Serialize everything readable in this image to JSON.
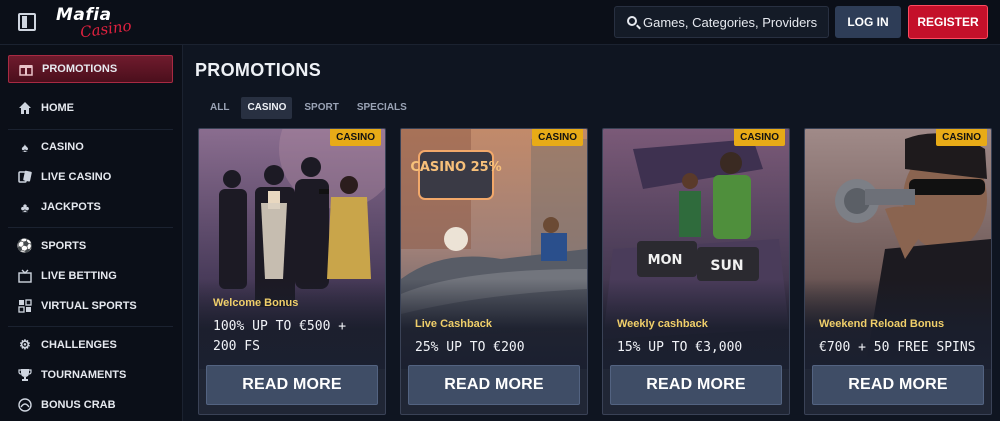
{
  "header": {
    "logo_main": "Mafia",
    "logo_script": "Casino",
    "search_placeholder": "Games, Categories, Providers",
    "login_label": "LOG IN",
    "register_label": "REGISTER"
  },
  "sidebar": {
    "items": [
      {
        "label": "PROMOTIONS",
        "icon": "gift-icon"
      },
      {
        "label": "HOME",
        "icon": "home-icon"
      },
      {
        "label": "CASINO",
        "icon": "spade-icon"
      },
      {
        "label": "LIVE CASINO",
        "icon": "cards-icon"
      },
      {
        "label": "JACKPOTS",
        "icon": "clover-icon"
      },
      {
        "label": "SPORTS",
        "icon": "football-icon"
      },
      {
        "label": "LIVE BETTING",
        "icon": "live-icon"
      },
      {
        "label": "VIRTUAL SPORTS",
        "icon": "virtual-icon"
      },
      {
        "label": "CHALLENGES",
        "icon": "gear-icon"
      },
      {
        "label": "TOURNAMENTS",
        "icon": "trophy-icon"
      },
      {
        "label": "BONUS CRAB",
        "icon": "crab-icon"
      }
    ]
  },
  "main": {
    "title": "PROMOTIONS",
    "tabs": [
      "ALL",
      "CASINO",
      "SPORT",
      "SPECIALS"
    ],
    "active_tab": "CASINO",
    "cards": [
      {
        "badge": "CASINO",
        "subtitle": "Welcome Bonus",
        "headline": "100% UP TO €500 + 200 FS",
        "button": "READ MORE"
      },
      {
        "badge": "CASINO",
        "subtitle": "Live Cashback",
        "headline": "25% UP TO €200",
        "button": "READ MORE",
        "art_text": "CASINO 25%"
      },
      {
        "badge": "CASINO",
        "subtitle": "Weekly cashback",
        "headline": "15% UP TO €3,000",
        "button": "READ MORE",
        "art_text_1": "MON",
        "art_text_2": "SUN"
      },
      {
        "badge": "CASINO",
        "subtitle": "Weekend Reload Bonus",
        "headline": "€700 + 50 FREE SPINS",
        "button": "READ MORE"
      }
    ]
  },
  "colors": {
    "accent_red": "#c4102a",
    "badge_gold": "#e8ab17",
    "subtitle_gold": "#f0cf6a",
    "button_slate": "#3f4d66"
  }
}
